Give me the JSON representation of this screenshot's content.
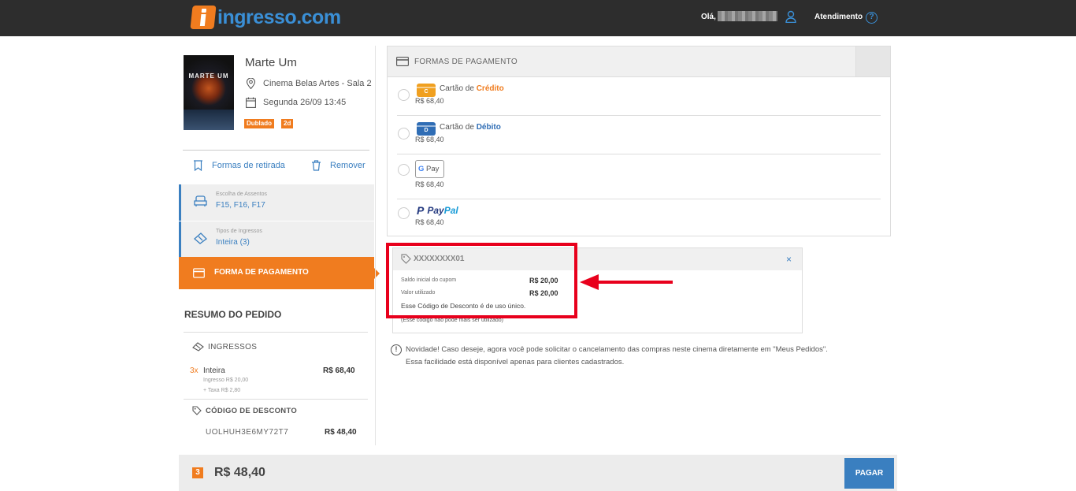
{
  "header": {
    "brand": "ingresso.com",
    "greeting": "Olá,",
    "support": "Atendimento",
    "help_glyph": "?"
  },
  "movie": {
    "poster_title": "MARTE UM",
    "title": "Marte Um",
    "cinema": "Cinema Belas Artes - Sala 2",
    "session": "Segunda 26/09 13:45",
    "tags": [
      "Dublado",
      "2d"
    ]
  },
  "actions": {
    "pickup": "Formas de retirada",
    "remove": "Remover"
  },
  "steps": [
    {
      "caption": "Escolha de Assentos",
      "value": "F15, F16, F17"
    },
    {
      "caption": "Tipos de Ingressos",
      "value": "Inteira (3)"
    }
  ],
  "active_step": "FORMA DE PAGAMENTO",
  "summary": {
    "title": "RESUMO DO PEDIDO",
    "tickets_title": "INGRESSOS",
    "qty": "3x",
    "ticket_type": "Inteira",
    "ticket_total": "R$ 68,40",
    "ticket_price": "Ingresso R$ 20,00",
    "ticket_fee": "+ Taxa R$ 2,80",
    "discount_title": "CÓDIGO DE DESCONTO",
    "discount_code": "UOLHUH3E6MY72T7",
    "discount_value": "R$ 48,40"
  },
  "payment": {
    "title": "FORMAS DE PAGAMENTO",
    "options": [
      {
        "name_prefix": "Cartão de ",
        "name_strong": "Crédito",
        "amount": "R$ 68,40",
        "badge": "C",
        "color": "#f0a020"
      },
      {
        "name_prefix": "Cartão de ",
        "name_strong": "Débito",
        "amount": "R$ 68,40",
        "badge": "D",
        "color": "#2f6db5"
      },
      {
        "name_prefix": "G",
        "name_strong": "Pay",
        "amount": "R$ 68,40"
      },
      {
        "name_prefix": "Pay",
        "name_strong": "Pal",
        "amount": "R$ 68,40"
      }
    ]
  },
  "coupon": {
    "code": "XXXXXXXX01",
    "close": "×",
    "saldo_label": "Saldo inicial do cupom",
    "saldo_value": "R$ 20,00",
    "valor_label": "Valor utilizado",
    "valor_value": "R$ 20,00",
    "uso": "Esse Código de Desconto é de uso único.",
    "nomais": "(Esse código não pode mais ser utilizado)"
  },
  "notice": {
    "glyph": "!",
    "line1": "Novidade! Caso deseje, agora você pode solicitar o cancelamento das compras neste cinema diretamente em \"Meus Pedidos\".",
    "line2": "Essa facilidade está disponível apenas para clientes cadastrados."
  },
  "footer": {
    "count": "3",
    "total": "R$ 48,40",
    "pay_button": "PAGAR"
  },
  "colors": {
    "accent_orange": "#f07c1f",
    "accent_blue": "#3a7fc0",
    "highlight_red": "#e8001c"
  }
}
